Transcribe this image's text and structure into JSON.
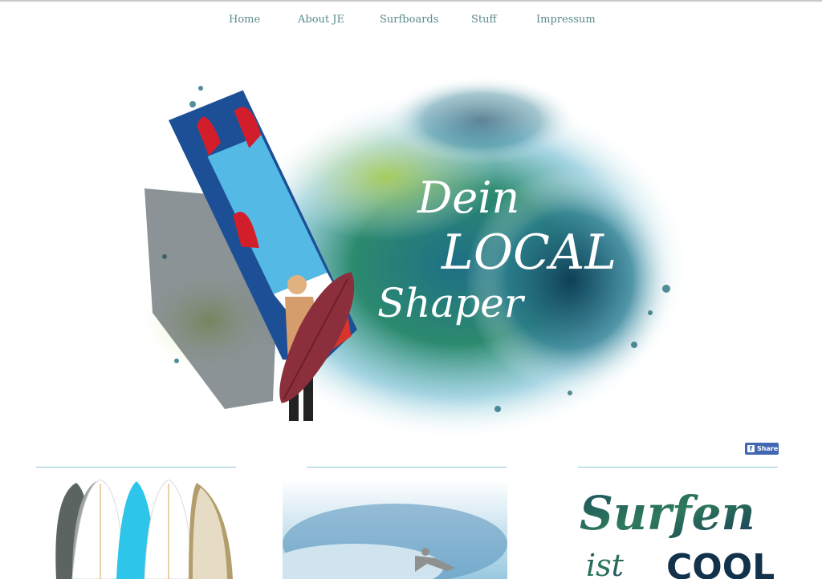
{
  "nav": {
    "items": [
      {
        "label": "Home"
      },
      {
        "label": "About JE"
      },
      {
        "label": "Surfboards"
      },
      {
        "label": "Stuff"
      },
      {
        "label": "Impressum"
      }
    ]
  },
  "hero": {
    "logo_text_line1": "Dein",
    "logo_text_line2": "LOCAL",
    "logo_text_line3": "Shaper"
  },
  "share": {
    "label": "Share",
    "icon": "facebook-icon"
  },
  "columns": {
    "third_image_text_line1": "Surfen",
    "third_image_text_line2": "ist",
    "third_image_text_line3": "COOL"
  },
  "colors": {
    "nav_link": "#5b8a8c",
    "column_rule": "#8ec7d4",
    "facebook_blue": "#4267b2"
  }
}
